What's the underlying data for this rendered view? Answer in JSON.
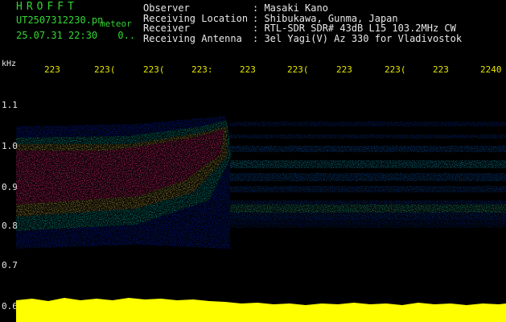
{
  "header": {
    "logo": "HROFFT",
    "filename": "UT2507312230.pn",
    "meteor_label": "meteor",
    "datetime": "25.07.31 22:30",
    "datetime_suffix": "0..",
    "observer_label": "Observer",
    "observer_value": ": Masaki Kano",
    "location_label": "Receiving Location",
    "location_value": ": Shibukawa, Gunma, Japan",
    "receiver_label": "Receiver",
    "receiver_value": ": RTL-SDR SDR# 43dB L15 103.2MHz CW",
    "antenna_label": "Receiving Antenna",
    "antenna_value": ": 3el Yagi(V) Az 330 for Vladivostok"
  },
  "axes": {
    "y_unit": "kHz",
    "y_ticks": [
      "1.1",
      "1.0",
      "0.9",
      "0.8",
      "0.7",
      "0.6"
    ],
    "time_ticks": [
      "223",
      "223(",
      "223(",
      "223:",
      "223",
      "223(",
      "223",
      "223(",
      "223",
      "2240"
    ]
  },
  "colors": {
    "text_green": "#33d633",
    "text_white": "#e8e8e8",
    "tick_yellow": "#e6e600",
    "signal_low": "#0000a0",
    "signal_mid": "#00c0c0",
    "signal_high": "#ff2a80",
    "power_bar": "#ffff00"
  }
}
